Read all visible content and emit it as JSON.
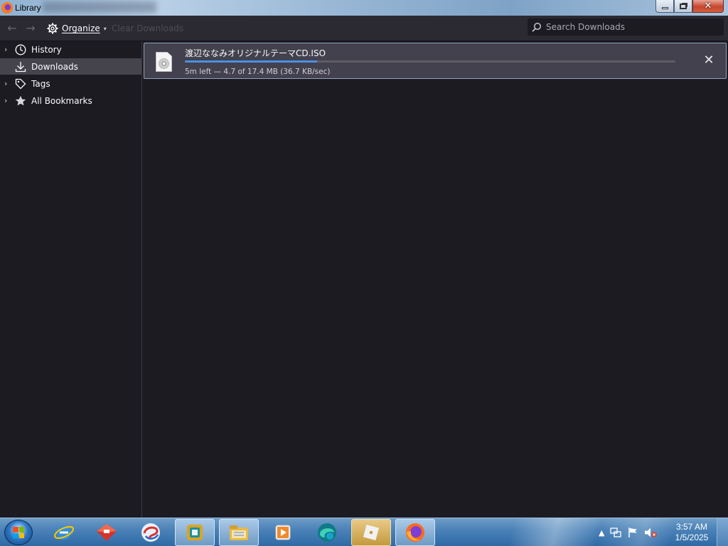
{
  "window": {
    "title": "Library",
    "controls": {
      "minimize": "minimize",
      "restore": "restore",
      "close": "✕"
    }
  },
  "toolbar": {
    "back_icon": "←",
    "forward_icon": "→",
    "organize_label": "Organize",
    "organize_caret": "▾",
    "clear_downloads_label": "Clear Downloads",
    "search_placeholder": "Search Downloads",
    "search_value": ""
  },
  "sidebar": {
    "items": [
      {
        "label": "History",
        "icon": "clock-icon",
        "expandable": true,
        "selected": false
      },
      {
        "label": "Downloads",
        "icon": "download-icon",
        "expandable": false,
        "selected": true
      },
      {
        "label": "Tags",
        "icon": "tag-icon",
        "expandable": true,
        "selected": false
      },
      {
        "label": "All Bookmarks",
        "icon": "star-icon",
        "expandable": true,
        "selected": false
      }
    ]
  },
  "downloads": [
    {
      "filename": "渡辺ななみオリジナルテーマCD.ISO",
      "status": "5m left — 4.7 of 17.4 MB (36.7 KB/sec)",
      "progress": 0.27,
      "icon": "disc-image-file-icon",
      "cancel_glyph": "✕"
    }
  ],
  "taskbar": {
    "pinned": [
      "internet-explorer-icon",
      "toolbox-app-icon",
      "swirl-app-icon",
      "teal-app-icon",
      "file-explorer-icon",
      "media-player-icon",
      "edge-app-icon",
      "roblox-icon",
      "firefox-icon"
    ],
    "tray_expand": "▲",
    "clock_time": "3:57 AM",
    "clock_date": "1/5/2025"
  },
  "colors": {
    "window_bg": "#1c1b22",
    "toolbar_bg": "#2b2a33",
    "selected_item_bg": "#45444d",
    "download_row_bg": "#42414d",
    "progress_fill": "#4a8fe6",
    "taskbar_blue": "#2f6aa6"
  }
}
